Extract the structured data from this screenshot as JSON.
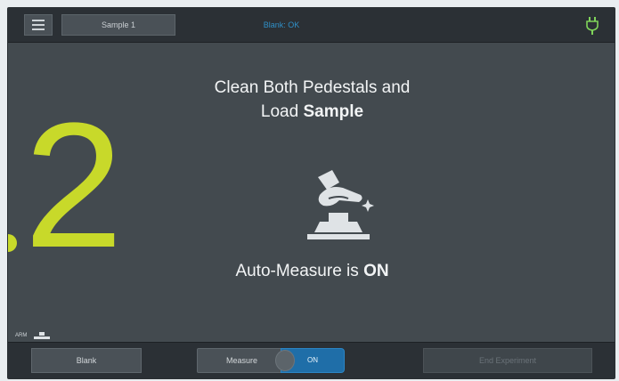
{
  "topbar": {
    "menu_icon": "hamburger-menu-icon",
    "sample_tab": "Sample 1",
    "blank_status": "Blank: OK",
    "status_icon": "plug-connected-icon",
    "status_color": "#7fd35a"
  },
  "main": {
    "instruction_line1": "Clean Both Pedestals and",
    "instruction_line2_prefix": "Load ",
    "instruction_line2_bold": "Sample",
    "step_number": "2",
    "step_color": "#c8d92a",
    "illustration_icon": "pedestal-wipe-icon",
    "automeasure_prefix": "Auto-Measure is ",
    "automeasure_state": "ON",
    "arm_label": "ARM"
  },
  "bottombar": {
    "blank_label": "Blank",
    "measure_label": "Measure",
    "measure_toggle_state": "ON",
    "end_label": "End Experiment"
  }
}
